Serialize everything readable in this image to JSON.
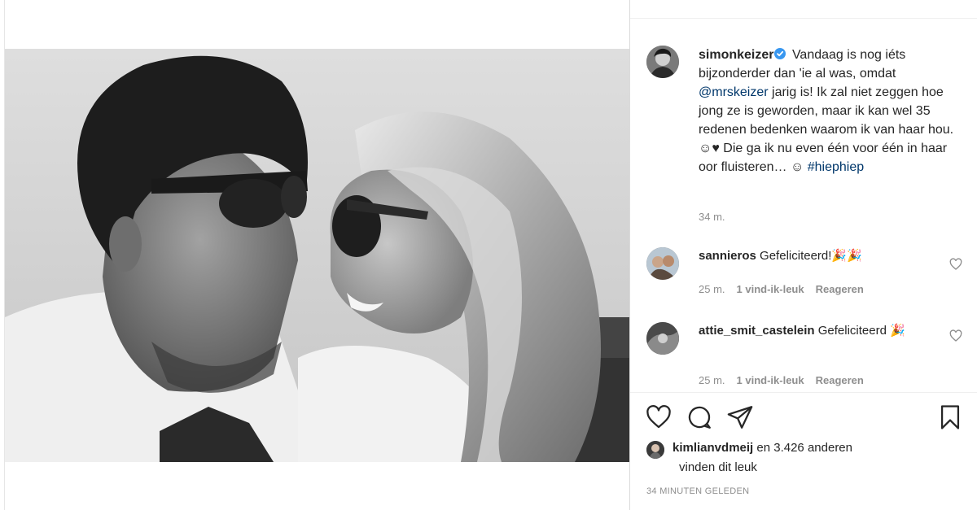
{
  "post": {
    "photo_alt": "",
    "author": {
      "username": "simonkeizer",
      "verified": true
    },
    "caption": {
      "part1": "Vandaag is nog iéts bijzonderder dan 'ie al was, omdat ",
      "mention": "@mrskeizer",
      "part2": " jarig is! Ik zal niet zeggen hoe jong ze is geworden, maar ik kan wel 35 redenen bedenken waarom ik van haar hou. ☺♥ Die ga ik nu even één voor één in haar oor fluisteren… ☺ ",
      "hashtag": "#hiephiep"
    },
    "caption_time": "34 m.",
    "comments": [
      {
        "username": "sannieros",
        "text": "Gefeliciteerd!🎉🎉",
        "time": "25 m.",
        "likes": "1 vind-ik-leuk",
        "reply": "Reageren"
      },
      {
        "username": "attie_smit_castelein",
        "text": "Gefeliciteerd 🎉",
        "time": "25 m.",
        "likes": "1 vind-ik-leuk",
        "reply": "Reageren"
      }
    ],
    "actions": {
      "like_icon": "heart-icon",
      "comment_icon": "comment-icon",
      "share_icon": "paper-plane-icon",
      "save_icon": "bookmark-icon"
    },
    "liked_by": {
      "username": "kimlianvdmeij",
      "rest": "en 3.426 anderen",
      "line2": "vinden dit leuk"
    },
    "timestamp": "34 MINUTEN GELEDEN"
  }
}
